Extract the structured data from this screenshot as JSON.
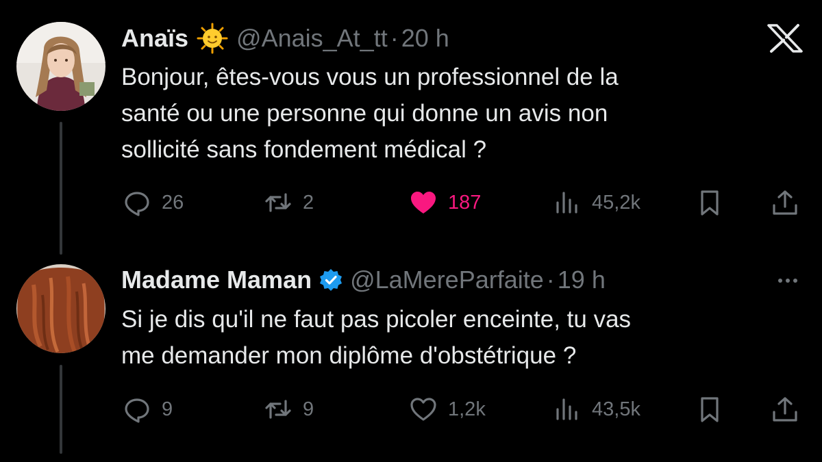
{
  "app": {
    "logo": "x-logo-icon"
  },
  "tweets": [
    {
      "name": "Anaïs",
      "emoji": "sun-face-emoji",
      "handle": "@Anais_At_tt",
      "separator": "·",
      "time": "20 h",
      "text": "Bonjour, êtes-vous vous un professionnel de la\nsanté ou une personne qui donne un avis non\nsollicité sans fondement médical ?",
      "replies": "26",
      "retweets": "2",
      "likes": "187",
      "liked": true,
      "views": "45,2k"
    },
    {
      "name": "Madame Maman",
      "verified": true,
      "handle": "@LaMereParfaite",
      "separator": "·",
      "time": "19 h",
      "text": "Si je dis qu'il ne faut pas picoler enceinte, tu vas\nme demander mon diplôme d'obstétrique ?",
      "replies": "9",
      "retweets": "9",
      "likes": "1,2k",
      "liked": false,
      "views": "43,5k"
    }
  ],
  "colors": {
    "background": "#000000",
    "text": "#e7e9ea",
    "muted": "#71767b",
    "like": "#f91880",
    "verified": "#1d9bf0",
    "thread_line": "#333639"
  }
}
